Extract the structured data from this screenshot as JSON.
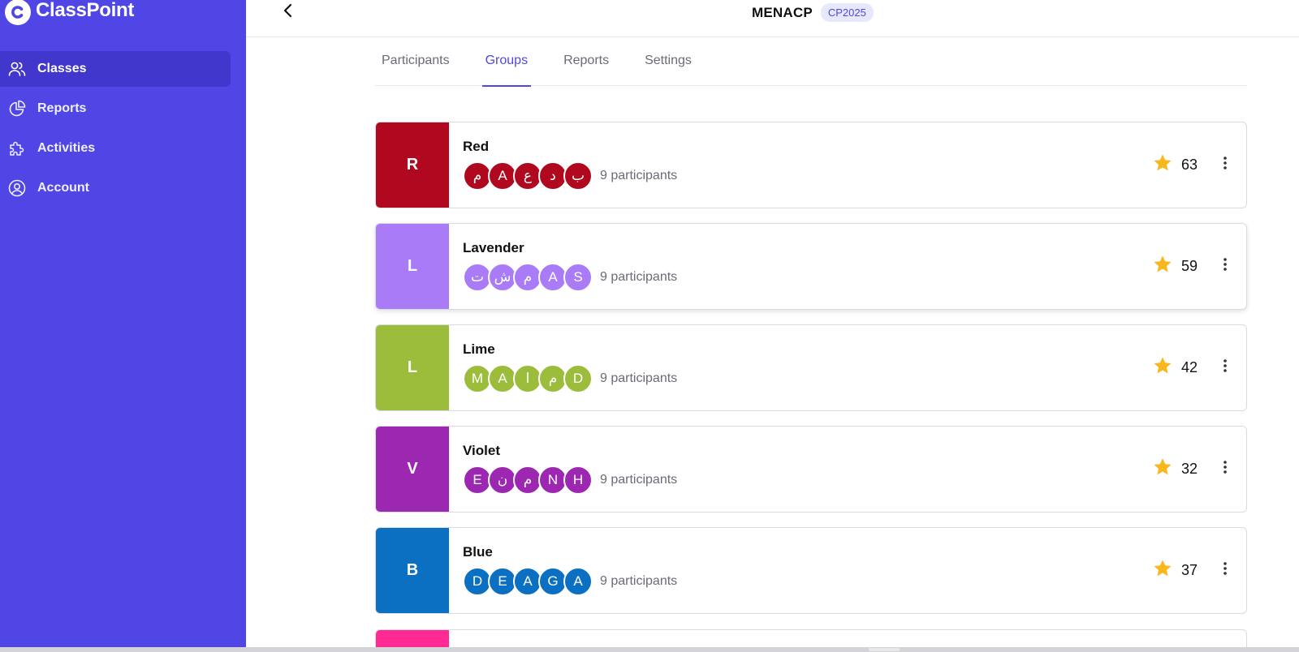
{
  "brand": {
    "name": "ClassPoint",
    "accent": "#4f46e5"
  },
  "sidebar": {
    "items": [
      {
        "label": "Classes",
        "icon": "users-icon",
        "active": true
      },
      {
        "label": "Reports",
        "icon": "pie-chart-icon",
        "active": false
      },
      {
        "label": "Activities",
        "icon": "puzzle-icon",
        "active": false
      },
      {
        "label": "Account",
        "icon": "user-circle-icon",
        "active": false
      }
    ]
  },
  "header": {
    "back_icon": "chevron-left-icon",
    "class_name": "MENACP",
    "class_code": "CP2025"
  },
  "tabs": [
    {
      "label": "Participants",
      "active": false
    },
    {
      "label": "Groups",
      "active": true
    },
    {
      "label": "Reports",
      "active": false
    },
    {
      "label": "Settings",
      "active": false
    }
  ],
  "groups": [
    {
      "letter": "R",
      "name": "Red",
      "color": "#b0081f",
      "avatars": [
        "م",
        "A",
        "ع",
        "د",
        "ب"
      ],
      "participants": "9 participants",
      "stars": "63"
    },
    {
      "letter": "L",
      "name": "Lavender",
      "color": "#a97bf7",
      "avatars": [
        "ت",
        "ش",
        "م",
        "A",
        "S"
      ],
      "participants": "9 participants",
      "stars": "59"
    },
    {
      "letter": "L",
      "name": "Lime",
      "color": "#9cbd3c",
      "avatars": [
        "M",
        "A",
        "ا",
        "م",
        "D"
      ],
      "participants": "9 participants",
      "stars": "42"
    },
    {
      "letter": "V",
      "name": "Violet",
      "color": "#9c27b0",
      "avatars": [
        "E",
        "ن",
        "م",
        "N",
        "H"
      ],
      "participants": "9 participants",
      "stars": "32"
    },
    {
      "letter": "B",
      "name": "Blue",
      "color": "#0b6fc2",
      "avatars": [
        "D",
        "E",
        "A",
        "G",
        "A"
      ],
      "participants": "9 participants",
      "stars": "37"
    }
  ],
  "next_group_color": "#ff2a93",
  "icons": {
    "star": "star-icon",
    "more": "more-vertical-icon"
  },
  "star_color": "#f6b81c"
}
